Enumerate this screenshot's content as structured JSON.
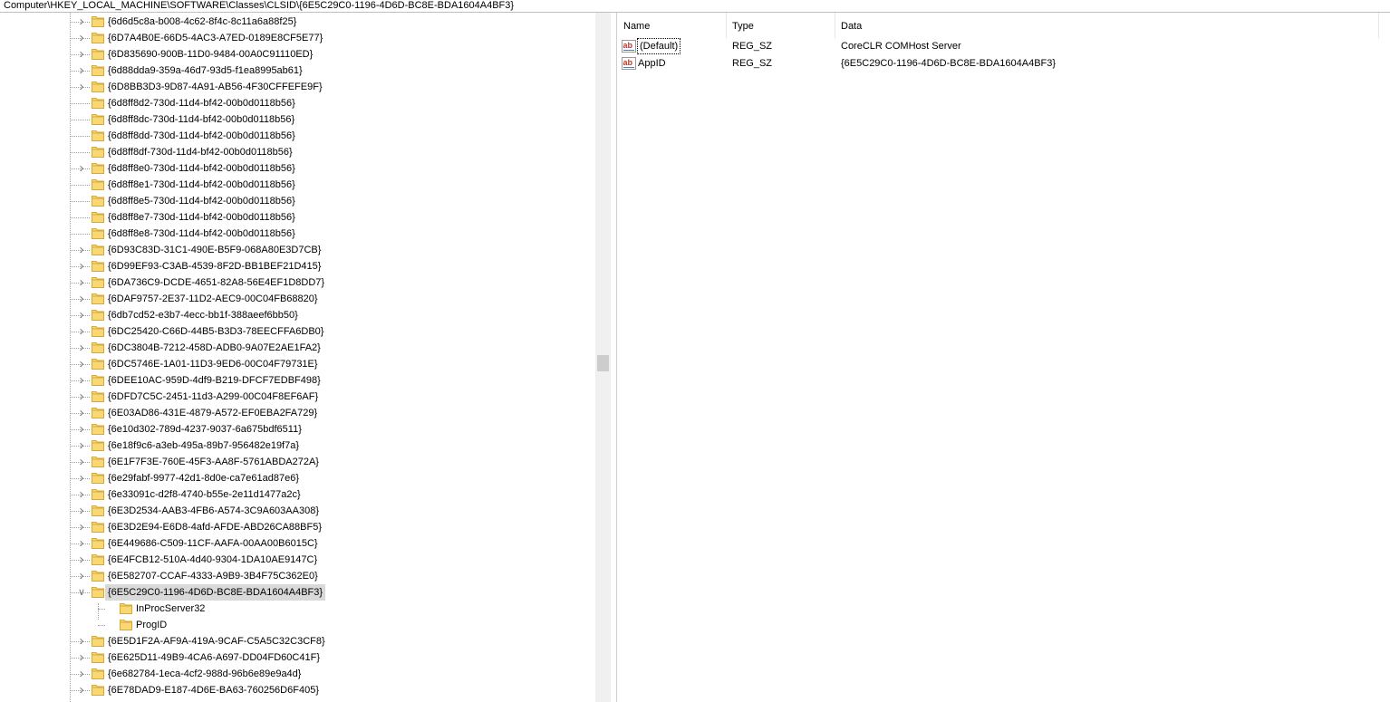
{
  "address_bar": {
    "path": "Computer\\HKEY_LOCAL_MACHINE\\SOFTWARE\\Classes\\CLSID\\{6E5C29C0-1196-4D6D-BC8E-BDA1604A4BF3}"
  },
  "tree": {
    "items": [
      {
        "label": "{6d6d5c8a-b008-4c62-8f4c-8c11a6a88f25}",
        "expander": "collapsed"
      },
      {
        "label": "{6D7A4B0E-66D5-4AC3-A7ED-0189E8CF5E77}",
        "expander": "collapsed"
      },
      {
        "label": "{6D835690-900B-11D0-9484-00A0C91110ED}",
        "expander": "collapsed"
      },
      {
        "label": "{6d88dda9-359a-46d7-93d5-f1ea8995ab61}",
        "expander": "collapsed"
      },
      {
        "label": "{6D8BB3D3-9D87-4A91-AB56-4F30CFFEFE9F}",
        "expander": "collapsed"
      },
      {
        "label": "{6d8ff8d2-730d-11d4-bf42-00b0d0118b56}",
        "expander": "none"
      },
      {
        "label": "{6d8ff8dc-730d-11d4-bf42-00b0d0118b56}",
        "expander": "none"
      },
      {
        "label": "{6d8ff8dd-730d-11d4-bf42-00b0d0118b56}",
        "expander": "none"
      },
      {
        "label": "{6d8ff8df-730d-11d4-bf42-00b0d0118b56}",
        "expander": "none"
      },
      {
        "label": "{6d8ff8e0-730d-11d4-bf42-00b0d0118b56}",
        "expander": "collapsed"
      },
      {
        "label": "{6d8ff8e1-730d-11d4-bf42-00b0d0118b56}",
        "expander": "none"
      },
      {
        "label": "{6d8ff8e5-730d-11d4-bf42-00b0d0118b56}",
        "expander": "none"
      },
      {
        "label": "{6d8ff8e7-730d-11d4-bf42-00b0d0118b56}",
        "expander": "none"
      },
      {
        "label": "{6d8ff8e8-730d-11d4-bf42-00b0d0118b56}",
        "expander": "none"
      },
      {
        "label": "{6D93C83D-31C1-490E-B5F9-068A80E3D7CB}",
        "expander": "collapsed"
      },
      {
        "label": "{6D99EF93-C3AB-4539-8F2D-BB1BEF21D415}",
        "expander": "collapsed"
      },
      {
        "label": "{6DA736C9-DCDE-4651-82A8-56E4EF1D8DD7}",
        "expander": "collapsed"
      },
      {
        "label": "{6DAF9757-2E37-11D2-AEC9-00C04FB68820}",
        "expander": "collapsed"
      },
      {
        "label": "{6db7cd52-e3b7-4ecc-bb1f-388aeef6bb50}",
        "expander": "collapsed"
      },
      {
        "label": "{6DC25420-C66D-44B5-B3D3-78EECFFA6DB0}",
        "expander": "collapsed"
      },
      {
        "label": "{6DC3804B-7212-458D-ADB0-9A07E2AE1FA2}",
        "expander": "collapsed"
      },
      {
        "label": "{6DC5746E-1A01-11D3-9ED6-00C04F79731E}",
        "expander": "collapsed"
      },
      {
        "label": "{6DEE10AC-959D-4df9-B219-DFCF7EDBF498}",
        "expander": "collapsed"
      },
      {
        "label": "{6DFD7C5C-2451-11d3-A299-00C04F8EF6AF}",
        "expander": "collapsed"
      },
      {
        "label": "{6E03AD86-431E-4879-A572-EF0EBA2FA729}",
        "expander": "collapsed"
      },
      {
        "label": "{6e10d302-789d-4237-9037-6a675bdf6511}",
        "expander": "collapsed"
      },
      {
        "label": "{6e18f9c6-a3eb-495a-89b7-956482e19f7a}",
        "expander": "collapsed"
      },
      {
        "label": "{6E1F7F3E-760E-45F3-AA8F-5761ABDA272A}",
        "expander": "collapsed"
      },
      {
        "label": "{6e29fabf-9977-42d1-8d0e-ca7e61ad87e6}",
        "expander": "collapsed"
      },
      {
        "label": "{6e33091c-d2f8-4740-b55e-2e11d1477a2c}",
        "expander": "collapsed"
      },
      {
        "label": "{6E3D2534-AAB3-4FB6-A574-3C9A603AA308}",
        "expander": "collapsed"
      },
      {
        "label": "{6E3D2E94-E6D8-4afd-AFDE-ABD26CA88BF5}",
        "expander": "collapsed"
      },
      {
        "label": "{6E449686-C509-11CF-AAFA-00AA00B6015C}",
        "expander": "collapsed"
      },
      {
        "label": "{6E4FCB12-510A-4d40-9304-1DA10AE9147C}",
        "expander": "collapsed"
      },
      {
        "label": "{6E582707-CCAF-4333-A9B9-3B4F75C362E0}",
        "expander": "collapsed"
      },
      {
        "label": "{6E5C29C0-1196-4D6D-BC8E-BDA1604A4BF3}",
        "expander": "expanded",
        "selected": true
      },
      {
        "label": "InProcServer32",
        "expander": "none",
        "child": true
      },
      {
        "label": "ProgID",
        "expander": "none",
        "child": true
      },
      {
        "label": "{6E5D1F2A-AF9A-419A-9CAF-C5A5C32C3CF8}",
        "expander": "collapsed"
      },
      {
        "label": "{6E625D11-49B9-4CA6-A697-DD04FD60C41F}",
        "expander": "collapsed"
      },
      {
        "label": "{6e682784-1eca-4cf2-988d-96b6e89e9a4d}",
        "expander": "collapsed"
      },
      {
        "label": "{6E78DAD9-E187-4D6E-BA63-760256D6F405}",
        "expander": "collapsed"
      }
    ]
  },
  "values_pane": {
    "columns": {
      "name": "Name",
      "type": "Type",
      "data": "Data"
    },
    "rows": [
      {
        "name": "(Default)",
        "type": "REG_SZ",
        "data": "CoreCLR COMHost Server",
        "focused": true
      },
      {
        "name": "AppID",
        "type": "REG_SZ",
        "data": "{6E5C29C0-1196-4D6D-BC8E-BDA1604A4BF3}"
      }
    ],
    "icon": "string-value-icon"
  },
  "colors": {
    "folder": "#f8d775",
    "folder_edge": "#d9a938",
    "selection": "#d9d9d9",
    "value_icon": "#c0392b"
  }
}
